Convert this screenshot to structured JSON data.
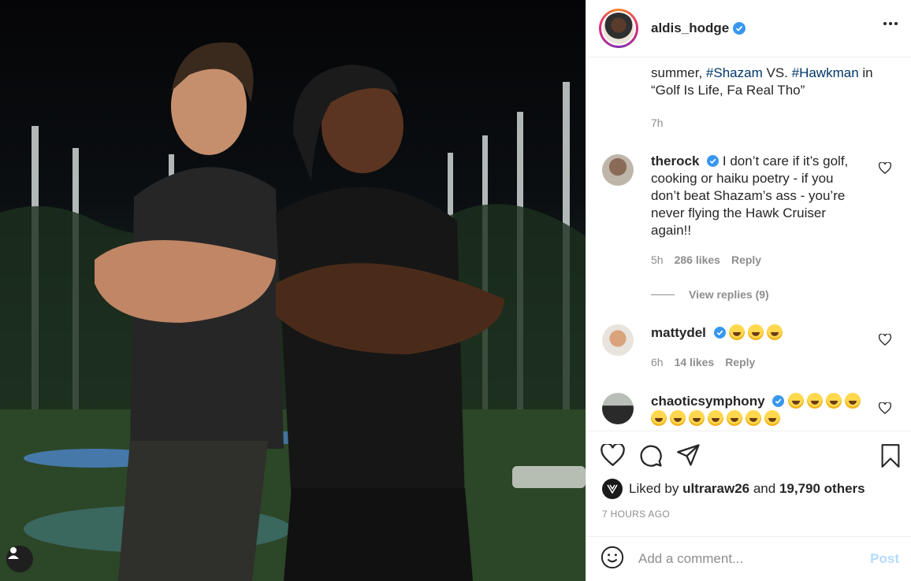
{
  "post": {
    "author": "aldis_hodge",
    "caption_lines": [
      "summer,",
      "VS.",
      "in",
      "“Golf Is Life, Fa Real Tho”"
    ],
    "hashtags": [
      "#Shazam",
      "#Hawkman"
    ],
    "caption_time": "7h"
  },
  "comments": [
    {
      "user": "therock",
      "text": "I don’t care if it’s golf, cooking or haiku poetry - if you don’t beat Shazam’s ass - you’re never flying the Hawk Cruiser again!!",
      "time": "5h",
      "likes": "286 likes",
      "reply": "Reply",
      "view_replies": "View replies (9)"
    },
    {
      "user": "mattydel",
      "time": "6h",
      "likes": "14 likes",
      "reply": "Reply"
    },
    {
      "user": "chaoticsymphony"
    }
  ],
  "likes": {
    "prefix": "Liked by",
    "user": "ultraraw26",
    "joiner": "and",
    "others": "19,790 others"
  },
  "post_time": "7 HOURS AGO",
  "comment_box": {
    "placeholder": "Add a comment...",
    "post_label": "Post"
  },
  "colors": {
    "hashtag": "#00376b",
    "verified": "#3897f0",
    "post_disabled": "#b3dbff",
    "muted": "#8e8e8e"
  },
  "icons": [
    "user-tag-icon",
    "verified-icon",
    "more-icon",
    "heart-icon",
    "comment-icon",
    "share-icon",
    "save-icon",
    "smile-icon"
  ]
}
